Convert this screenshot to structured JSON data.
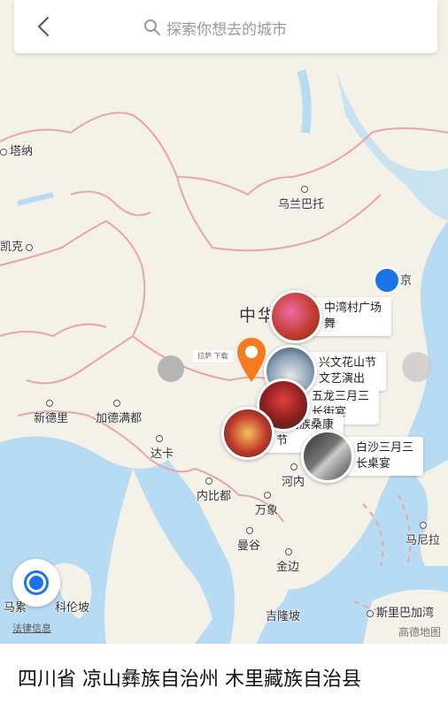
{
  "header": {
    "back_icon": "chevron-left-icon",
    "search_icon": "search-icon",
    "search_placeholder": "探索你想去的城市"
  },
  "map": {
    "country_label": "中华",
    "cities": [
      "塔纳",
      "乌兰巴托",
      "凯克",
      "新德里",
      "加德满都",
      "达卡",
      "内比都",
      "河内",
      "万象",
      "曼谷",
      "金边",
      "马尼拉",
      "吉隆坡",
      "斯里巴加湾",
      "马累",
      "科伦坡",
      "京"
    ],
    "marker_tooltip": "拉萨 下载",
    "events": [
      {
        "label": "中湾村广场舞"
      },
      {
        "label": "兴文花山节文艺演出"
      },
      {
        "label": "五龙三月三长街宴"
      },
      {
        "label": "布朗族桑康节"
      },
      {
        "label": "白沙三月三长桌宴"
      }
    ],
    "colors": {
      "land": "#f4f1e9",
      "water": "#b6dbf2",
      "border": "#e9a5a5",
      "marker": "#f47b20",
      "locate": "#1a73e8"
    }
  },
  "controls": {
    "locate_icon": "locate-icon",
    "legal_label": "法律信息",
    "map_logo": "高德地图"
  },
  "footer": {
    "location": "四川省 凉山彝族自治州 木里藏族自治县"
  }
}
